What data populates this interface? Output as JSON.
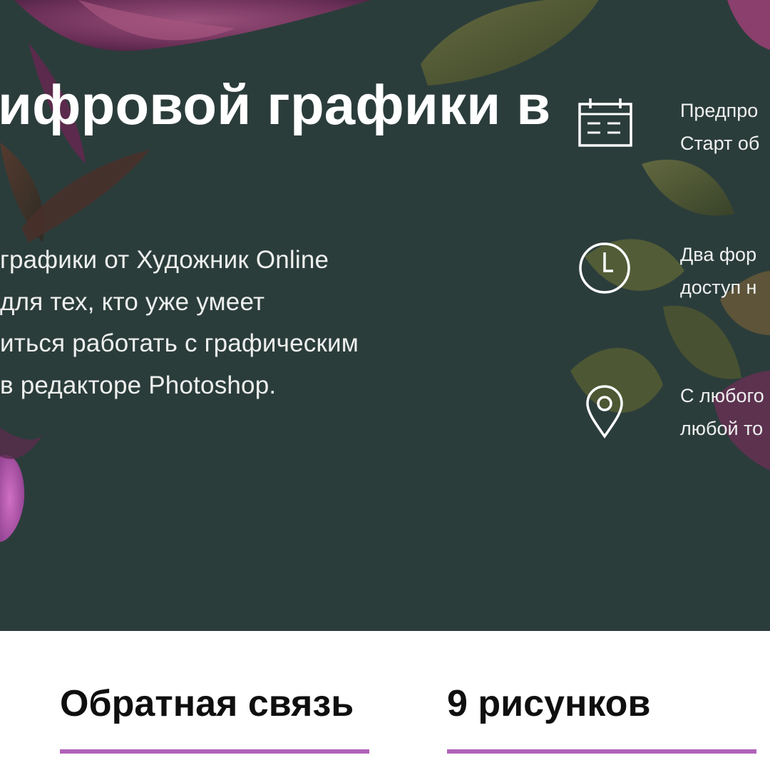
{
  "hero": {
    "title": "ифровой графики в",
    "description_lines": [
      "графики от Художник Online",
      "для тех, кто уже умеет",
      "иться работать с графическим",
      "в редакторе Photoshop."
    ]
  },
  "features": [
    {
      "icon": "calendar-icon",
      "lines": [
        "Предпро",
        "Старт об"
      ]
    },
    {
      "icon": "clock-icon",
      "lines": [
        "Два фор",
        "доступ н"
      ]
    },
    {
      "icon": "location-pin-icon",
      "lines": [
        "С любого",
        "любой то"
      ]
    }
  ],
  "tabs": [
    {
      "label": "Обратная связь"
    },
    {
      "label": "9 рисунков"
    }
  ],
  "colors": {
    "hero_background": "#2b3d3b",
    "accent": "#b062b8",
    "text_light": "#eef0ee",
    "text_dark": "#0f0f0f"
  }
}
